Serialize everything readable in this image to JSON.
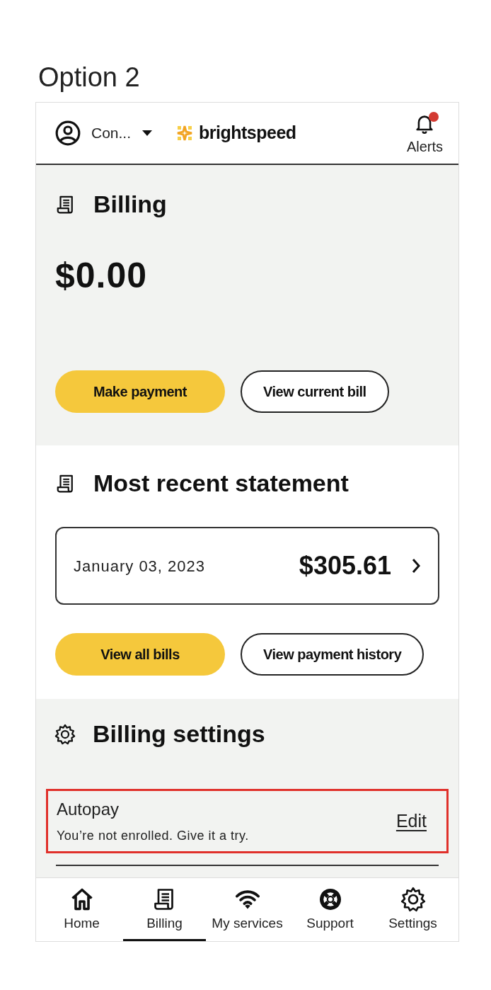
{
  "heading": "Option 2",
  "header": {
    "account": "Con...",
    "logo": "brightspeed",
    "alerts": {
      "label": "Alerts",
      "unread": true
    }
  },
  "billing": {
    "title": "Billing",
    "balance": "$0.00",
    "buttons": [
      {
        "label": "Make payment",
        "kind": "primary"
      },
      {
        "label": "View current bill",
        "kind": "secondary"
      }
    ]
  },
  "statement": {
    "title": "Most recent statement",
    "date": "January 03, 2023",
    "amount": "$305.61",
    "buttons": [
      {
        "label": "View all bills",
        "kind": "primary"
      },
      {
        "label": "View payment history",
        "kind": "secondary"
      }
    ]
  },
  "settings": {
    "title": "Billing settings",
    "rows": [
      {
        "title": "Autopay",
        "description": "You’re not enrolled. Give it a try.",
        "action": "Edit",
        "highlighted": true
      }
    ]
  },
  "nav": [
    {
      "label": "Home",
      "selected": false
    },
    {
      "label": "Billing",
      "selected": true
    },
    {
      "label": "My services",
      "selected": false
    },
    {
      "label": "Support",
      "selected": false
    },
    {
      "label": "Settings",
      "selected": false
    }
  ]
}
